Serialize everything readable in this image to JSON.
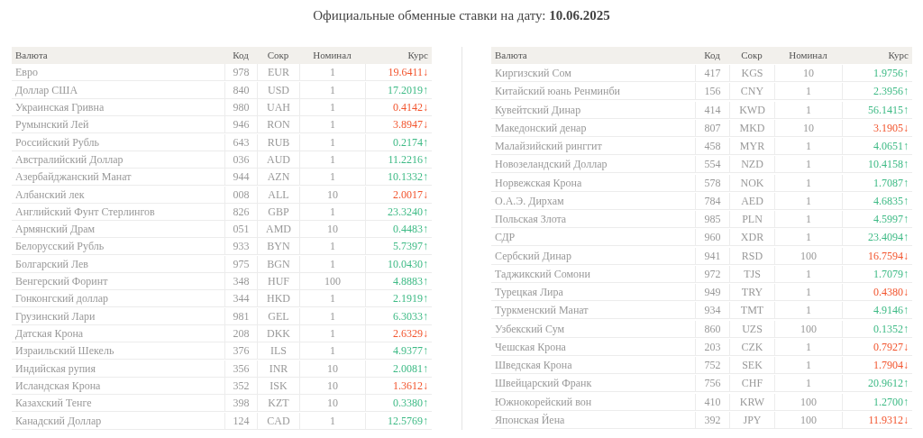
{
  "title": {
    "text": "Официальные обменные ставки на дату: ",
    "date": "10.06.2025"
  },
  "tables": [
    {
      "columns": [
        "Валюта",
        "Код",
        "Сокр",
        "Номинал",
        "Курс"
      ],
      "rows": [
        {
          "name": "Евро",
          "code": "978",
          "abbr": "EUR",
          "nominal": "1",
          "rate": "19.6411↓",
          "kind": "down"
        },
        {
          "name": "Доллар США",
          "code": "840",
          "abbr": "USD",
          "nominal": "1",
          "rate": "17.2019↑",
          "kind": "up"
        },
        {
          "name": "Украинская Гривна",
          "code": "980",
          "abbr": "UAH",
          "nominal": "1",
          "rate": "0.4142↓",
          "kind": "down"
        },
        {
          "name": "Румынский Лей",
          "code": "946",
          "abbr": "RON",
          "nominal": "1",
          "rate": "3.8947↓",
          "kind": "down"
        },
        {
          "name": "Российский Рубль",
          "code": "643",
          "abbr": "RUB",
          "nominal": "1",
          "rate": "0.2174↑",
          "kind": "up"
        },
        {
          "name": "Австралийский Доллар",
          "code": "036",
          "abbr": "AUD",
          "nominal": "1",
          "rate": "11.2216↑",
          "kind": "up"
        },
        {
          "name": "Азербайджанский Манат",
          "code": "944",
          "abbr": "AZN",
          "nominal": "1",
          "rate": "10.1332↑",
          "kind": "up"
        },
        {
          "name": "Албанский лек",
          "code": "008",
          "abbr": "ALL",
          "nominal": "10",
          "rate": "2.0017↓",
          "kind": "down"
        },
        {
          "name": "Английский Фунт Стерлингов",
          "code": "826",
          "abbr": "GBP",
          "nominal": "1",
          "rate": "23.3240↑",
          "kind": "up"
        },
        {
          "name": "Армянский Драм",
          "code": "051",
          "abbr": "AMD",
          "nominal": "10",
          "rate": "0.4483↑",
          "kind": "up"
        },
        {
          "name": "Белорусский Рубль",
          "code": "933",
          "abbr": "BYN",
          "nominal": "1",
          "rate": "5.7397↑",
          "kind": "up"
        },
        {
          "name": "Болгарский Лев",
          "code": "975",
          "abbr": "BGN",
          "nominal": "1",
          "rate": "10.0430↑",
          "kind": "up"
        },
        {
          "name": "Венгерский Форинт",
          "code": "348",
          "abbr": "HUF",
          "nominal": "100",
          "rate": "4.8883↑",
          "kind": "up"
        },
        {
          "name": "Гонконгский доллар",
          "code": "344",
          "abbr": "HKD",
          "nominal": "1",
          "rate": "2.1919↑",
          "kind": "up"
        },
        {
          "name": "Грузинский Лари",
          "code": "981",
          "abbr": "GEL",
          "nominal": "1",
          "rate": "6.3033↑",
          "kind": "up"
        },
        {
          "name": "Датская Крона",
          "code": "208",
          "abbr": "DKK",
          "nominal": "1",
          "rate": "2.6329↓",
          "kind": "down"
        },
        {
          "name": "Израильский Шекель",
          "code": "376",
          "abbr": "ILS",
          "nominal": "1",
          "rate": "4.9377↑",
          "kind": "up"
        },
        {
          "name": "Индийская рупия",
          "code": "356",
          "abbr": "INR",
          "nominal": "10",
          "rate": "2.0081↑",
          "kind": "up"
        },
        {
          "name": "Исландская Крона",
          "code": "352",
          "abbr": "ISK",
          "nominal": "10",
          "rate": "1.3612↓",
          "kind": "down"
        },
        {
          "name": "Казахский Тенге",
          "code": "398",
          "abbr": "KZT",
          "nominal": "10",
          "rate": "0.3380↑",
          "kind": "up"
        },
        {
          "name": "Канадский Доллар",
          "code": "124",
          "abbr": "CAD",
          "nominal": "1",
          "rate": "12.5769↑",
          "kind": "up"
        }
      ]
    },
    {
      "columns": [
        "Валюта",
        "Код",
        "Сокр",
        "Номинал",
        "Курс"
      ],
      "rows": [
        {
          "name": "Киргизский Сом",
          "code": "417",
          "abbr": "KGS",
          "nominal": "10",
          "rate": "1.9756↑",
          "kind": "up"
        },
        {
          "name": "Китайский юань Ренминби",
          "code": "156",
          "abbr": "CNY",
          "nominal": "1",
          "rate": "2.3956↑",
          "kind": "up"
        },
        {
          "name": "Кувейтский Динар",
          "code": "414",
          "abbr": "KWD",
          "nominal": "1",
          "rate": "56.1415↑",
          "kind": "up"
        },
        {
          "name": "Македонский денар",
          "code": "807",
          "abbr": "MKD",
          "nominal": "10",
          "rate": "3.1905↓",
          "kind": "down"
        },
        {
          "name": "Малайзийский ринггит",
          "code": "458",
          "abbr": "MYR",
          "nominal": "1",
          "rate": "4.0651↑",
          "kind": "up"
        },
        {
          "name": "Новозеландский Доллар",
          "code": "554",
          "abbr": "NZD",
          "nominal": "1",
          "rate": "10.4158↑",
          "kind": "up"
        },
        {
          "name": "Норвежская Крона",
          "code": "578",
          "abbr": "NOK",
          "nominal": "1",
          "rate": "1.7087↑",
          "kind": "up"
        },
        {
          "name": "О.А.Э. Дирхам",
          "code": "784",
          "abbr": "AED",
          "nominal": "1",
          "rate": "4.6835↑",
          "kind": "up"
        },
        {
          "name": "Польская Злота",
          "code": "985",
          "abbr": "PLN",
          "nominal": "1",
          "rate": "4.5997↑",
          "kind": "up"
        },
        {
          "name": "СДР",
          "code": "960",
          "abbr": "XDR",
          "nominal": "1",
          "rate": "23.4094↑",
          "kind": "up"
        },
        {
          "name": "Сербский Динар",
          "code": "941",
          "abbr": "RSD",
          "nominal": "100",
          "rate": "16.7594↓",
          "kind": "down"
        },
        {
          "name": "Таджикский Сомони",
          "code": "972",
          "abbr": "TJS",
          "nominal": "1",
          "rate": "1.7079↑",
          "kind": "up"
        },
        {
          "name": "Турецкая Лира",
          "code": "949",
          "abbr": "TRY",
          "nominal": "1",
          "rate": "0.4380↓",
          "kind": "down"
        },
        {
          "name": "Туркменский Манат",
          "code": "934",
          "abbr": "TMT",
          "nominal": "1",
          "rate": "4.9146↑",
          "kind": "up"
        },
        {
          "name": "Узбекский Сум",
          "code": "860",
          "abbr": "UZS",
          "nominal": "100",
          "rate": "0.1352↑",
          "kind": "up"
        },
        {
          "name": "Чешская Крона",
          "code": "203",
          "abbr": "CZK",
          "nominal": "1",
          "rate": "0.7927↓",
          "kind": "down"
        },
        {
          "name": "Шведская Крона",
          "code": "752",
          "abbr": "SEK",
          "nominal": "1",
          "rate": "1.7904↓",
          "kind": "down"
        },
        {
          "name": "Швейцарский Франк",
          "code": "756",
          "abbr": "CHF",
          "nominal": "1",
          "rate": "20.9612↑",
          "kind": "up"
        },
        {
          "name": "Южнокорейский вон",
          "code": "410",
          "abbr": "KRW",
          "nominal": "100",
          "rate": "1.2700↑",
          "kind": "up"
        },
        {
          "name": "Японская Йена",
          "code": "392",
          "abbr": "JPY",
          "nominal": "100",
          "rate": "11.9312↓",
          "kind": "down"
        }
      ]
    }
  ]
}
